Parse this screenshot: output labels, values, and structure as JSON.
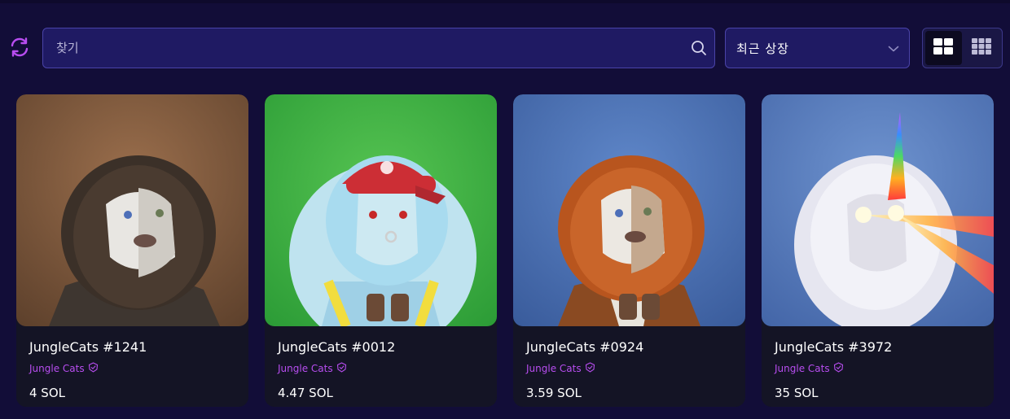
{
  "toolbar": {
    "search_placeholder": "찾기",
    "sort_selected": "최근 상장"
  },
  "colors": {
    "accent": "#b84df0",
    "input_bg": "#1f1a63",
    "page_bg": "#120d38",
    "card_bg": "#141425"
  },
  "icons": {
    "refresh": "refresh-icon",
    "search": "search-icon",
    "sort": "chevron-down-icon",
    "large_grid": "large-grid-icon",
    "small_grid": "small-grid-icon",
    "verified": "verified-badge-icon"
  },
  "cards": [
    {
      "title": "JungleCats #1241",
      "collection": "Jungle Cats",
      "price": "4 SOL"
    },
    {
      "title": "JungleCats #0012",
      "collection": "Jungle Cats",
      "price": "4.47 SOL"
    },
    {
      "title": "JungleCats #0924",
      "collection": "Jungle Cats",
      "price": "3.59 SOL"
    },
    {
      "title": "JungleCats #3972",
      "collection": "Jungle Cats",
      "price": "35 SOL"
    }
  ]
}
